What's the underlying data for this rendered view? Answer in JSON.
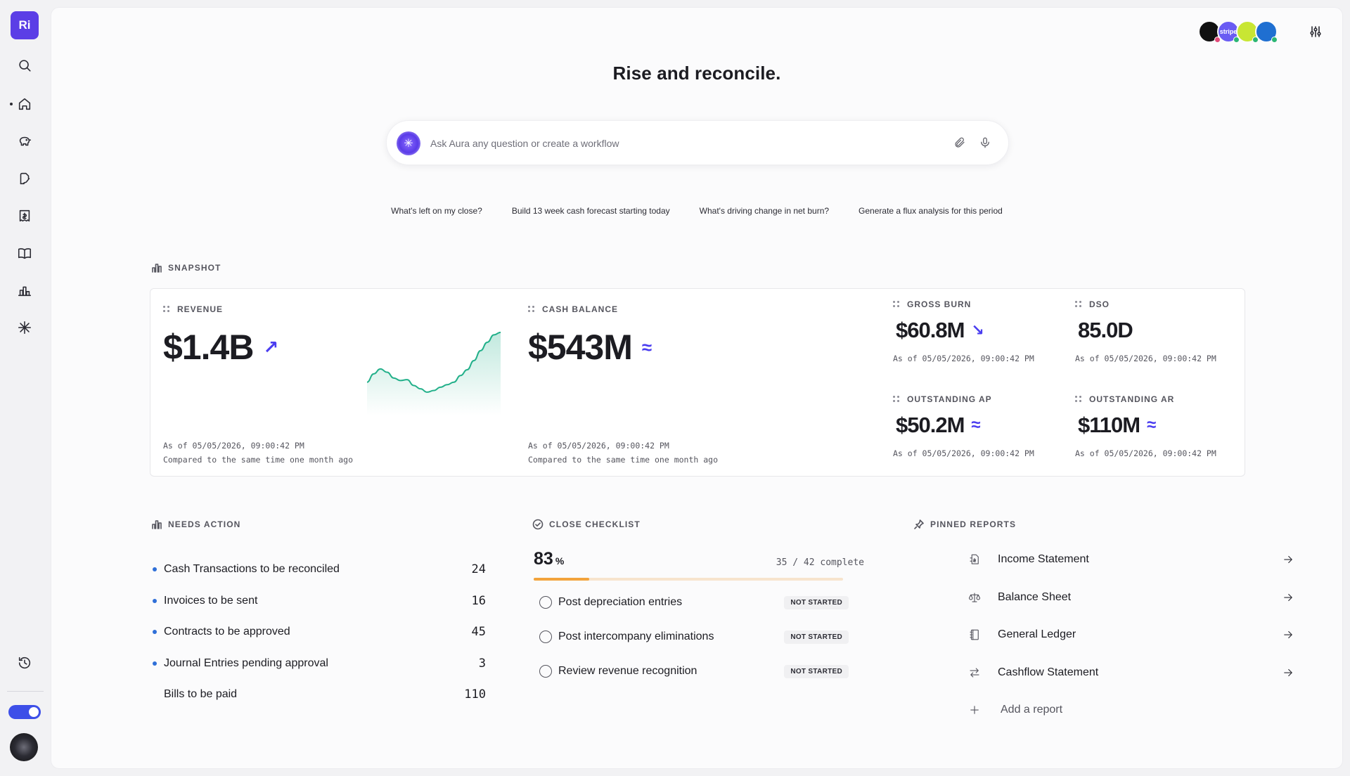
{
  "sidebar": {
    "logo": "Ri",
    "icons": [
      "search-icon",
      "home-icon",
      "piggy-bank-icon",
      "file-signature-icon",
      "receipt-icon",
      "book-icon",
      "bar-chart-icon",
      "aura-spark-icon",
      "history-icon"
    ]
  },
  "header": {
    "integrations": [
      {
        "name": "integration-1",
        "text": "",
        "color": "#111111",
        "status": "#e24a7a"
      },
      {
        "name": "stripe",
        "text": "stripe",
        "color": "#6a5cf3",
        "status": "#2bb673"
      },
      {
        "name": "integration-3",
        "text": "",
        "color": "#c8e633",
        "status": "#2bb673"
      },
      {
        "name": "integration-4",
        "text": "",
        "color": "#1f6fd1",
        "status": "#2bb673"
      }
    ],
    "settings_icon": "sliders-icon"
  },
  "hero": {
    "title": "Rise and reconcile.",
    "ask_placeholder": "Ask Aura any question or create a workflow"
  },
  "suggestions": [
    "What's left on my close?",
    "Build 13 week cash forecast starting today",
    "What's driving change in net burn?",
    "Generate a flux analysis for this period"
  ],
  "snapshot": {
    "label": "SNAPSHOT",
    "revenue": {
      "label": "REVENUE",
      "value": "$1.4B",
      "trend": "↗",
      "asof": "As of 05/05/2026, 09:00:42 PM",
      "compare": "Compared to the same time one month ago"
    },
    "cash_balance": {
      "label": "CASH BALANCE",
      "value": "$543M",
      "trend": "≈",
      "asof": "As of 05/05/2026, 09:00:42 PM",
      "compare": "Compared to the same time one month ago"
    },
    "gross_burn": {
      "label": "GROSS BURN",
      "value": "$60.8M",
      "trend": "↘",
      "asof": "As of 05/05/2026, 09:00:42 PM"
    },
    "dso": {
      "label": "DSO",
      "value": "85.0D",
      "trend": "",
      "asof": "As of 05/05/2026, 09:00:42 PM"
    },
    "outstanding_ap": {
      "label": "OUTSTANDING AP",
      "value": "$50.2M",
      "trend": "≈",
      "asof": "As of 05/05/2026, 09:00:42 PM"
    },
    "outstanding_ar": {
      "label": "OUTSTANDING AR",
      "value": "$110M",
      "trend": "≈",
      "asof": "As of 05/05/2026, 09:00:42 PM"
    }
  },
  "chart_data": {
    "type": "area",
    "x": [
      0,
      1,
      2,
      3,
      4,
      5,
      6,
      7,
      8,
      9,
      10,
      11,
      12,
      13,
      14,
      15,
      16,
      17,
      18,
      19,
      20
    ],
    "values": [
      40,
      50,
      56,
      52,
      45,
      42,
      43,
      36,
      32,
      28,
      30,
      34,
      37,
      40,
      48,
      55,
      66,
      78,
      88,
      97,
      100
    ],
    "ylim": [
      0,
      110
    ],
    "color": "#23b08a"
  },
  "needs_action": {
    "label": "NEEDS ACTION",
    "items": [
      {
        "label": "Cash Transactions to be reconciled",
        "count": "24",
        "dot": true
      },
      {
        "label": "Invoices to be sent",
        "count": "16",
        "dot": true
      },
      {
        "label": "Contracts to be approved",
        "count": "45",
        "dot": true
      },
      {
        "label": "Journal Entries pending approval",
        "count": "3",
        "dot": true
      },
      {
        "label": "Bills to be paid",
        "count": "110",
        "dot": false
      }
    ]
  },
  "close_checklist": {
    "label": "CLOSE CHECKLIST",
    "percent": "83",
    "percent_unit": "%",
    "progress": 0.18,
    "complete_text": "35 / 42 complete",
    "tasks": [
      {
        "label": "Post depreciation entries",
        "status": "NOT STARTED"
      },
      {
        "label": "Post intercompany eliminations",
        "status": "NOT STARTED"
      },
      {
        "label": "Review revenue recognition",
        "status": "NOT STARTED"
      }
    ]
  },
  "pinned_reports": {
    "label": "PINNED REPORTS",
    "items": [
      {
        "label": "Income Statement",
        "icon": "income-statement-icon"
      },
      {
        "label": "Balance Sheet",
        "icon": "scale-icon"
      },
      {
        "label": "General Ledger",
        "icon": "ledger-icon"
      },
      {
        "label": "Cashflow Statement",
        "icon": "transfer-icon"
      }
    ],
    "add_label": "Add a report"
  }
}
